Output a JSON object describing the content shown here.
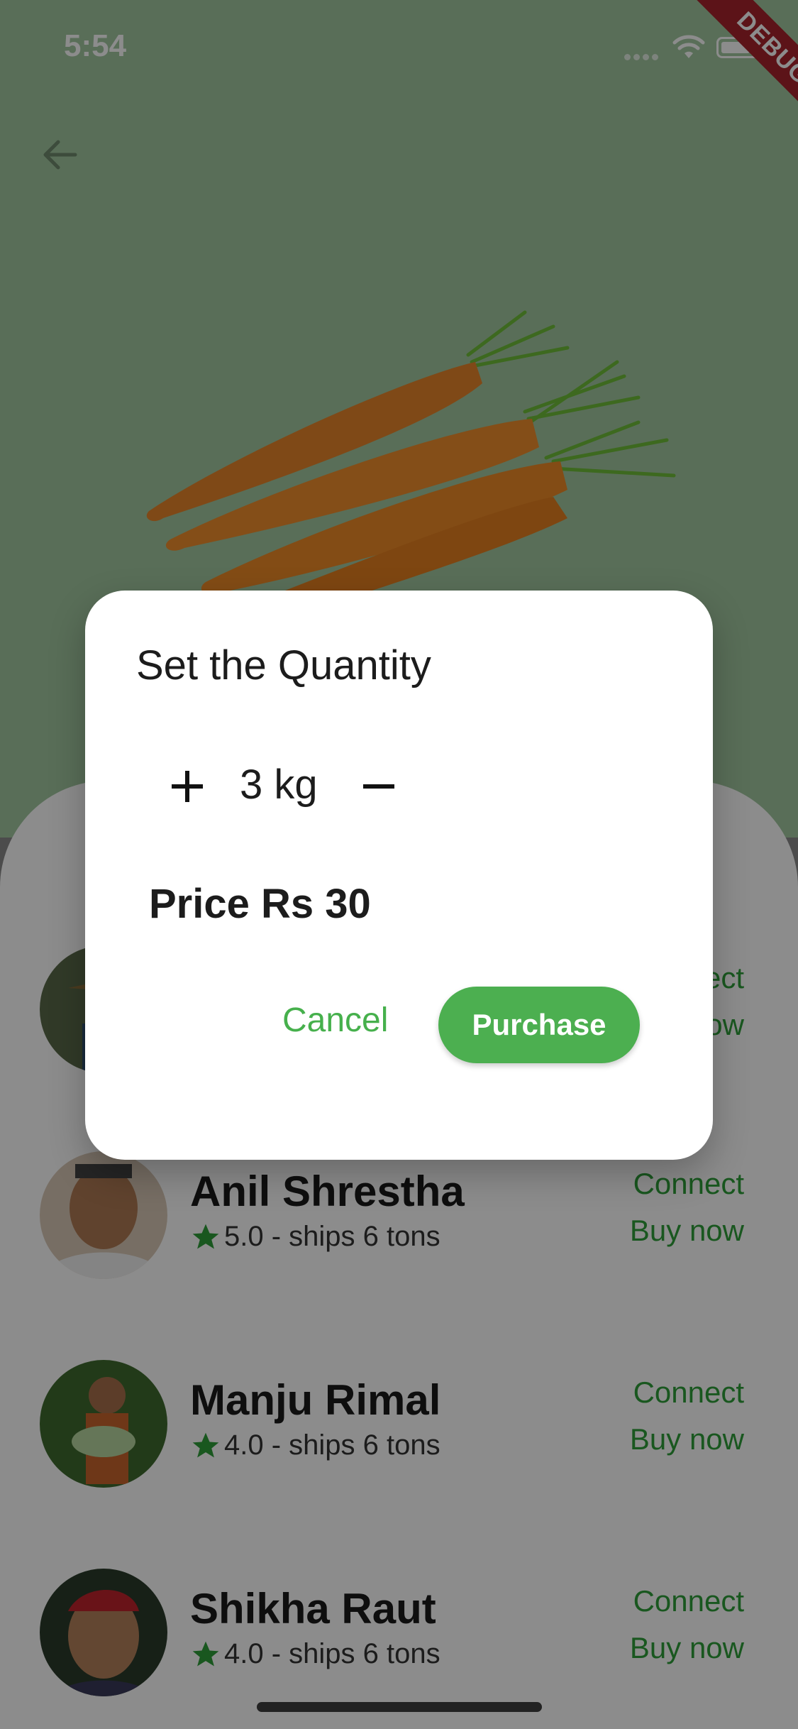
{
  "status_bar": {
    "time": "5:54",
    "debug_label": "DEBUG"
  },
  "dialog": {
    "title": "Set the Quantity",
    "quantity": "3 kg",
    "price": "Price Rs 30",
    "cancel_label": "Cancel",
    "purchase_label": "Purchase"
  },
  "farmers": [
    {
      "name": "",
      "rating": "",
      "connect_label": "Connect",
      "buy_label": "Buy now",
      "avatar_icon": "farmer-avatar-1"
    },
    {
      "name": "Anil Shrestha",
      "rating": "5.0 - ships 6 tons",
      "connect_label": "Connect",
      "buy_label": "Buy now",
      "avatar_icon": "farmer-avatar-2"
    },
    {
      "name": "Manju Rimal",
      "rating": "4.0 - ships 6 tons",
      "connect_label": "Connect",
      "buy_label": "Buy now",
      "avatar_icon": "farmer-avatar-3"
    },
    {
      "name": "Shikha Raut",
      "rating": "4.0 - ships 6 tons",
      "connect_label": "Connect",
      "buy_label": "Buy now",
      "avatar_icon": "farmer-avatar-4"
    }
  ],
  "colors": {
    "hero_bg": "#a2c9a0",
    "accent_green": "#4caf50",
    "link_green": "#2e9e3a",
    "debug_red": "#a8242c",
    "star_green": "#2e9e3a"
  },
  "icons": {
    "back": "arrow-back-icon",
    "plus": "plus-icon",
    "minus": "minus-icon",
    "star": "star-icon",
    "wifi": "wifi-icon",
    "battery": "battery-icon",
    "signal": "signal-icon"
  }
}
